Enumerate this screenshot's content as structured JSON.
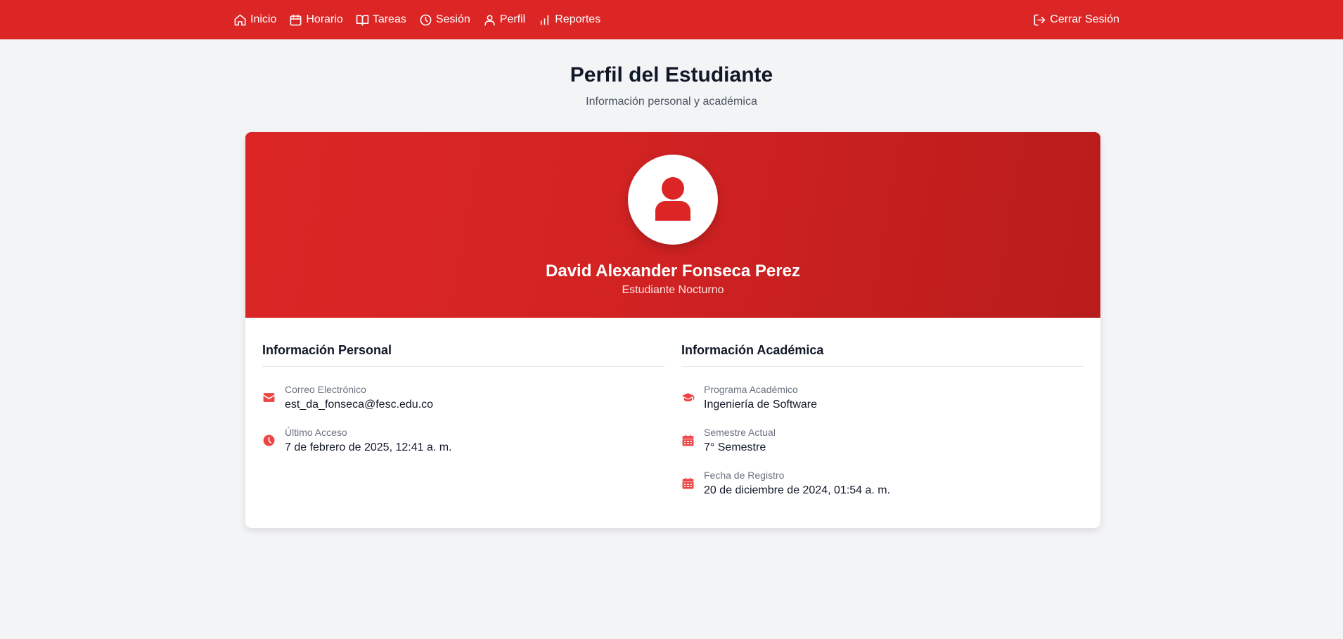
{
  "nav": {
    "items": [
      {
        "label": "Inicio",
        "icon": "home-icon"
      },
      {
        "label": "Horario",
        "icon": "calendar-icon"
      },
      {
        "label": "Tareas",
        "icon": "book-icon"
      },
      {
        "label": "Sesión",
        "icon": "clock-icon"
      },
      {
        "label": "Perfil",
        "icon": "user-icon"
      },
      {
        "label": "Reportes",
        "icon": "bar-chart-icon"
      }
    ],
    "logout": {
      "label": "Cerrar Sesión",
      "icon": "logout-icon"
    }
  },
  "page": {
    "title": "Perfil del Estudiante",
    "subtitle": "Información personal y académica"
  },
  "profile": {
    "name": "David Alexander Fonseca Perez",
    "role": "Estudiante Nocturno",
    "avatar_icon": "user-avatar-icon"
  },
  "personal": {
    "title": "Información Personal",
    "items": [
      {
        "label": "Correo Electrónico",
        "value": "est_da_fonseca@fesc.edu.co",
        "icon": "envelope-icon"
      },
      {
        "label": "Último Acceso",
        "value": "7 de febrero de 2025, 12:41 a. m.",
        "icon": "clock-icon"
      }
    ]
  },
  "academic": {
    "title": "Información Académica",
    "items": [
      {
        "label": "Programa Académico",
        "value": "Ingeniería de Software",
        "icon": "graduation-cap-icon"
      },
      {
        "label": "Semestre Actual",
        "value": "7° Semestre",
        "icon": "calendar-icon"
      },
      {
        "label": "Fecha de Registro",
        "value": "20 de diciembre de 2024, 01:54 a. m.",
        "icon": "calendar-icon"
      }
    ]
  },
  "colors": {
    "brand": "#dc2626",
    "brand_dark": "#b91c1c",
    "icon": "#ef4444",
    "background": "#f3f4f6"
  }
}
